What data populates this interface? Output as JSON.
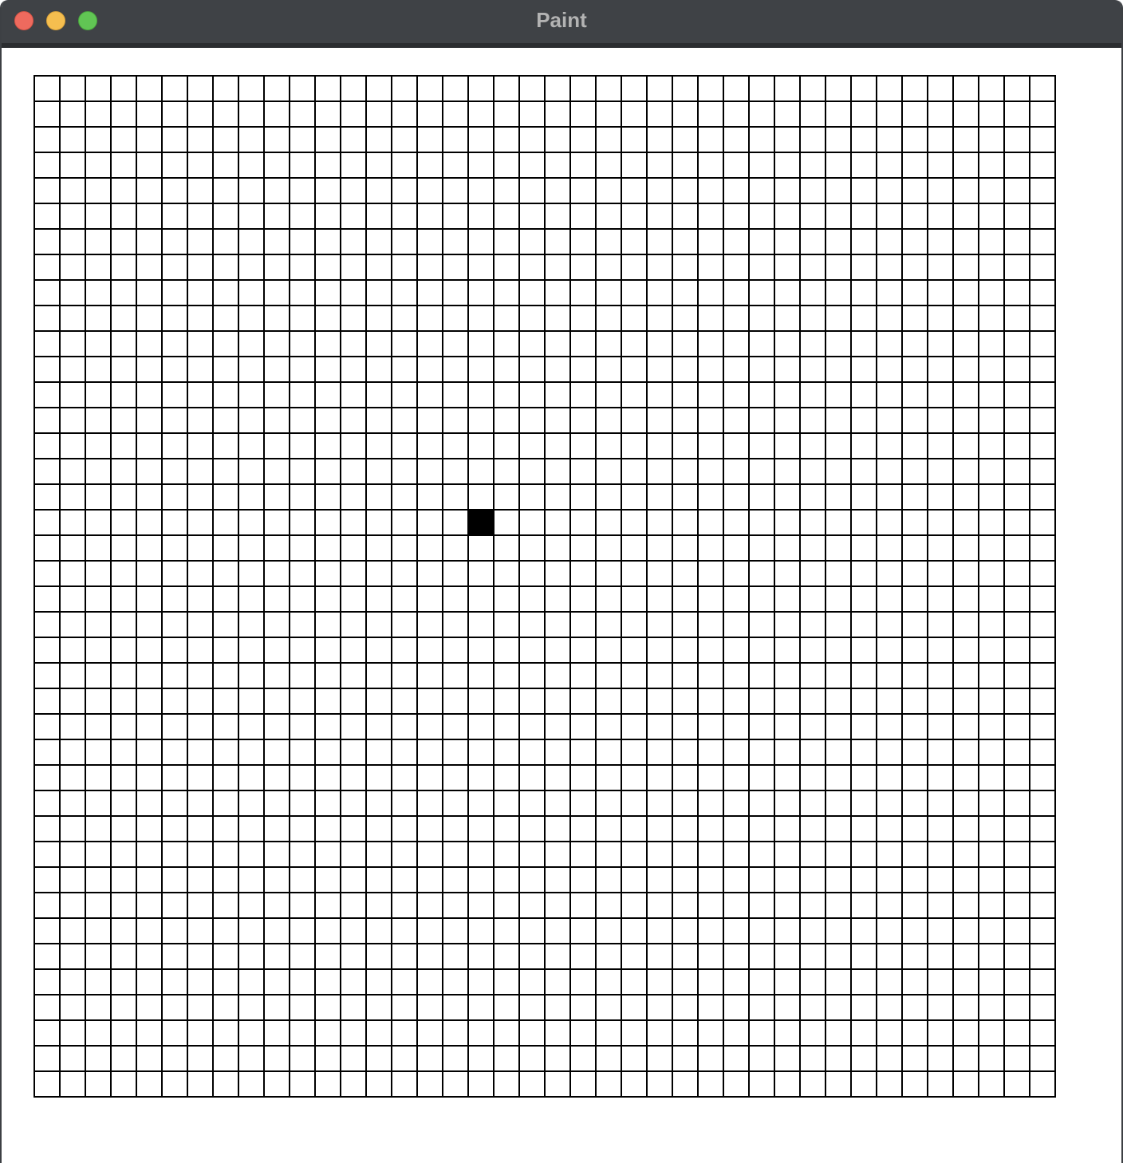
{
  "window": {
    "title": "Paint"
  },
  "canvas": {
    "columns": 40,
    "rows": 40,
    "background_color": "#ffffff",
    "grid_line_color": "#000000",
    "paint_color": "#000000",
    "filled_cells": [
      {
        "row": 17,
        "col": 17
      }
    ]
  },
  "colors": {
    "titlebar": "#3f4246",
    "close_button": "#ee6a5e",
    "minimize_button": "#f5be4f",
    "zoom_button": "#61c554"
  }
}
